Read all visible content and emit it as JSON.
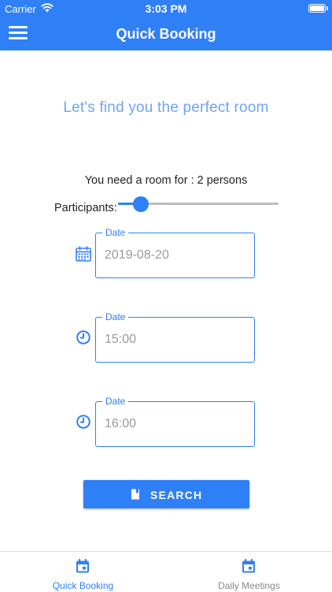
{
  "status_bar": {
    "carrier": "Carrier",
    "time": "3:03 PM"
  },
  "nav": {
    "title": "Quick Booking",
    "menu_icon": "hamburger-menu-icon"
  },
  "subtitle": "Let's find you the perfect room",
  "room_for": "You need a room for : 2 persons",
  "participants": {
    "label": "Participants:",
    "slider_fraction": 0.14
  },
  "fields": [
    {
      "label": "Date",
      "value": "2019-08-20",
      "icon": "calendar-icon"
    },
    {
      "label": "Date",
      "value": "15:00",
      "icon": "clock-icon"
    },
    {
      "label": "Date",
      "value": "16:00",
      "icon": "clock-icon"
    }
  ],
  "search": {
    "label": "SEARCH",
    "icon": "book-icon"
  },
  "tabs": [
    {
      "label": "Quick Booking",
      "active": true,
      "icon": "calendar-icon"
    },
    {
      "label": "Daily Meetings",
      "active": false,
      "icon": "calendar-icon"
    }
  ],
  "colors": {
    "primary": "#2f80f6",
    "subtitle": "#6ea6f5",
    "inactive_tab": "#8a8a8a",
    "value_text": "#9a9a9a"
  }
}
